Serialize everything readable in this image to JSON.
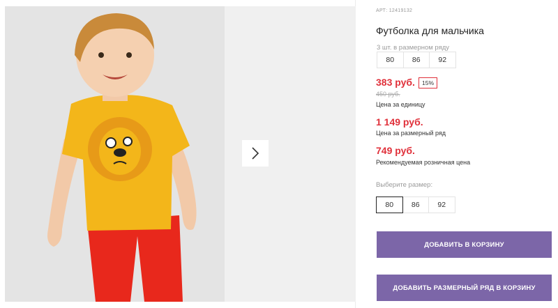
{
  "gallery": {
    "next_icon": "chevron-right-icon",
    "image_description_colors": {
      "shirt": "#f3b61a",
      "pants": "#e8281c",
      "background": "#e4e4e4"
    }
  },
  "product": {
    "article": "АРТ: 12419132",
    "title": "Футболка для мальчика",
    "set_label": "3 шт. в размерном ряду",
    "set_sizes": [
      "80",
      "86",
      "92"
    ],
    "price_unit": "383 руб.",
    "discount": "15%",
    "old_price": "450 руб.",
    "price_unit_caption": "Цена за единицу",
    "price_set": "1 149 руб.",
    "price_set_caption": "Цена за размерный ряд",
    "price_retail": "749 руб.",
    "price_retail_caption": "Рекомендуемая розничная цена",
    "choose_size_label": "Выберите размер:",
    "sizes": [
      "80",
      "86",
      "92"
    ],
    "selected_size": "80"
  },
  "actions": {
    "add_to_cart": "ДОБАВИТЬ В КОРЗИНУ",
    "add_set_to_cart": "ДОБАВИТЬ РАЗМЕРНЫЙ РЯД В КОРЗИНУ"
  },
  "colors": {
    "accent": "#7c66a8",
    "price": "#e0303a"
  }
}
